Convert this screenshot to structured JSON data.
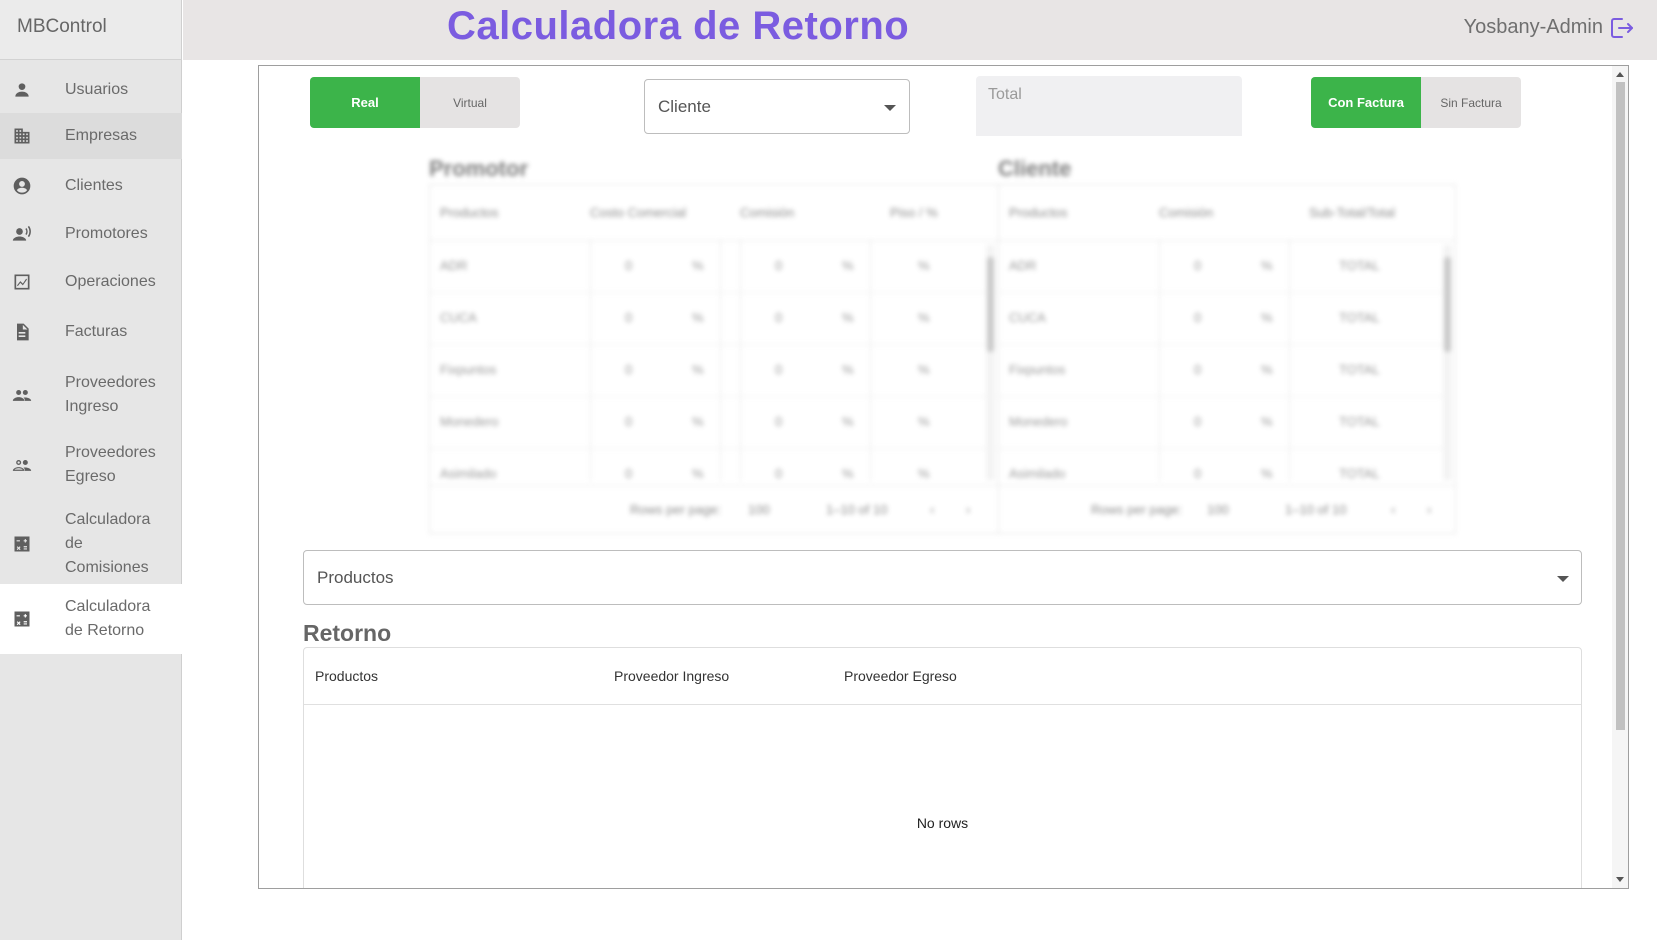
{
  "app": {
    "brand": "MBControl",
    "title": "Calculadora de Retorno",
    "user": "Yosbany-Admin"
  },
  "sidebar": {
    "items": [
      {
        "label": "Usuarios",
        "icon": "person-icon"
      },
      {
        "label": "Empresas",
        "icon": "building-icon"
      },
      {
        "label": "Clientes",
        "icon": "account-circle-icon"
      },
      {
        "label": "Promotores",
        "icon": "record-voice-icon"
      },
      {
        "label": "Operaciones",
        "icon": "operations-icon"
      },
      {
        "label": "Facturas",
        "icon": "document-icon"
      },
      {
        "label": "Proveedores\nIngreso",
        "icon": "people-icon"
      },
      {
        "label": "Proveedores\nEgreso",
        "icon": "people-outline-icon"
      },
      {
        "label": "Calculadora\nde\nComisiones",
        "icon": "calculator-icon"
      },
      {
        "label": "Calculadora\nde Retorno",
        "icon": "calculator-icon"
      }
    ]
  },
  "controls": {
    "mode_on": "Real",
    "mode_off": "Virtual",
    "cliente_select": "Cliente",
    "total_placeholder": "Total",
    "factura_on": "Con Factura",
    "factura_off": "Sin Factura"
  },
  "promotor": {
    "title": "Promotor",
    "headers": [
      "Productos",
      "Costo Comercial",
      "Comisión",
      "Piso / %"
    ],
    "rows": [
      "ADR",
      "CUCA",
      "Fixpuntos",
      "Monedero",
      "Asimilado"
    ],
    "cell_value": "0",
    "pct": "%",
    "rows_per_page_label": "Rows per page:",
    "rows_per_page": "100",
    "range": "1–10 of 10"
  },
  "cliente": {
    "title": "Cliente",
    "headers": [
      "Productos",
      "Comisión",
      "Sub-Total/Total"
    ],
    "rows": [
      "ADR",
      "CUCA",
      "Fixpuntos",
      "Monedero",
      "Asimilado"
    ],
    "cell_value": "0",
    "pct": "%",
    "total": "TOTAL",
    "rows_per_page_label": "Rows per page:",
    "rows_per_page": "100",
    "range": "1–10 of 10"
  },
  "productos_select": "Productos",
  "retorno": {
    "title": "Retorno",
    "headers": [
      "Productos",
      "Proveedor Ingreso",
      "Proveedor Egreso"
    ],
    "empty": "No rows"
  },
  "colors": {
    "accent": "#7b5ce0",
    "green": "#3cb44a"
  }
}
